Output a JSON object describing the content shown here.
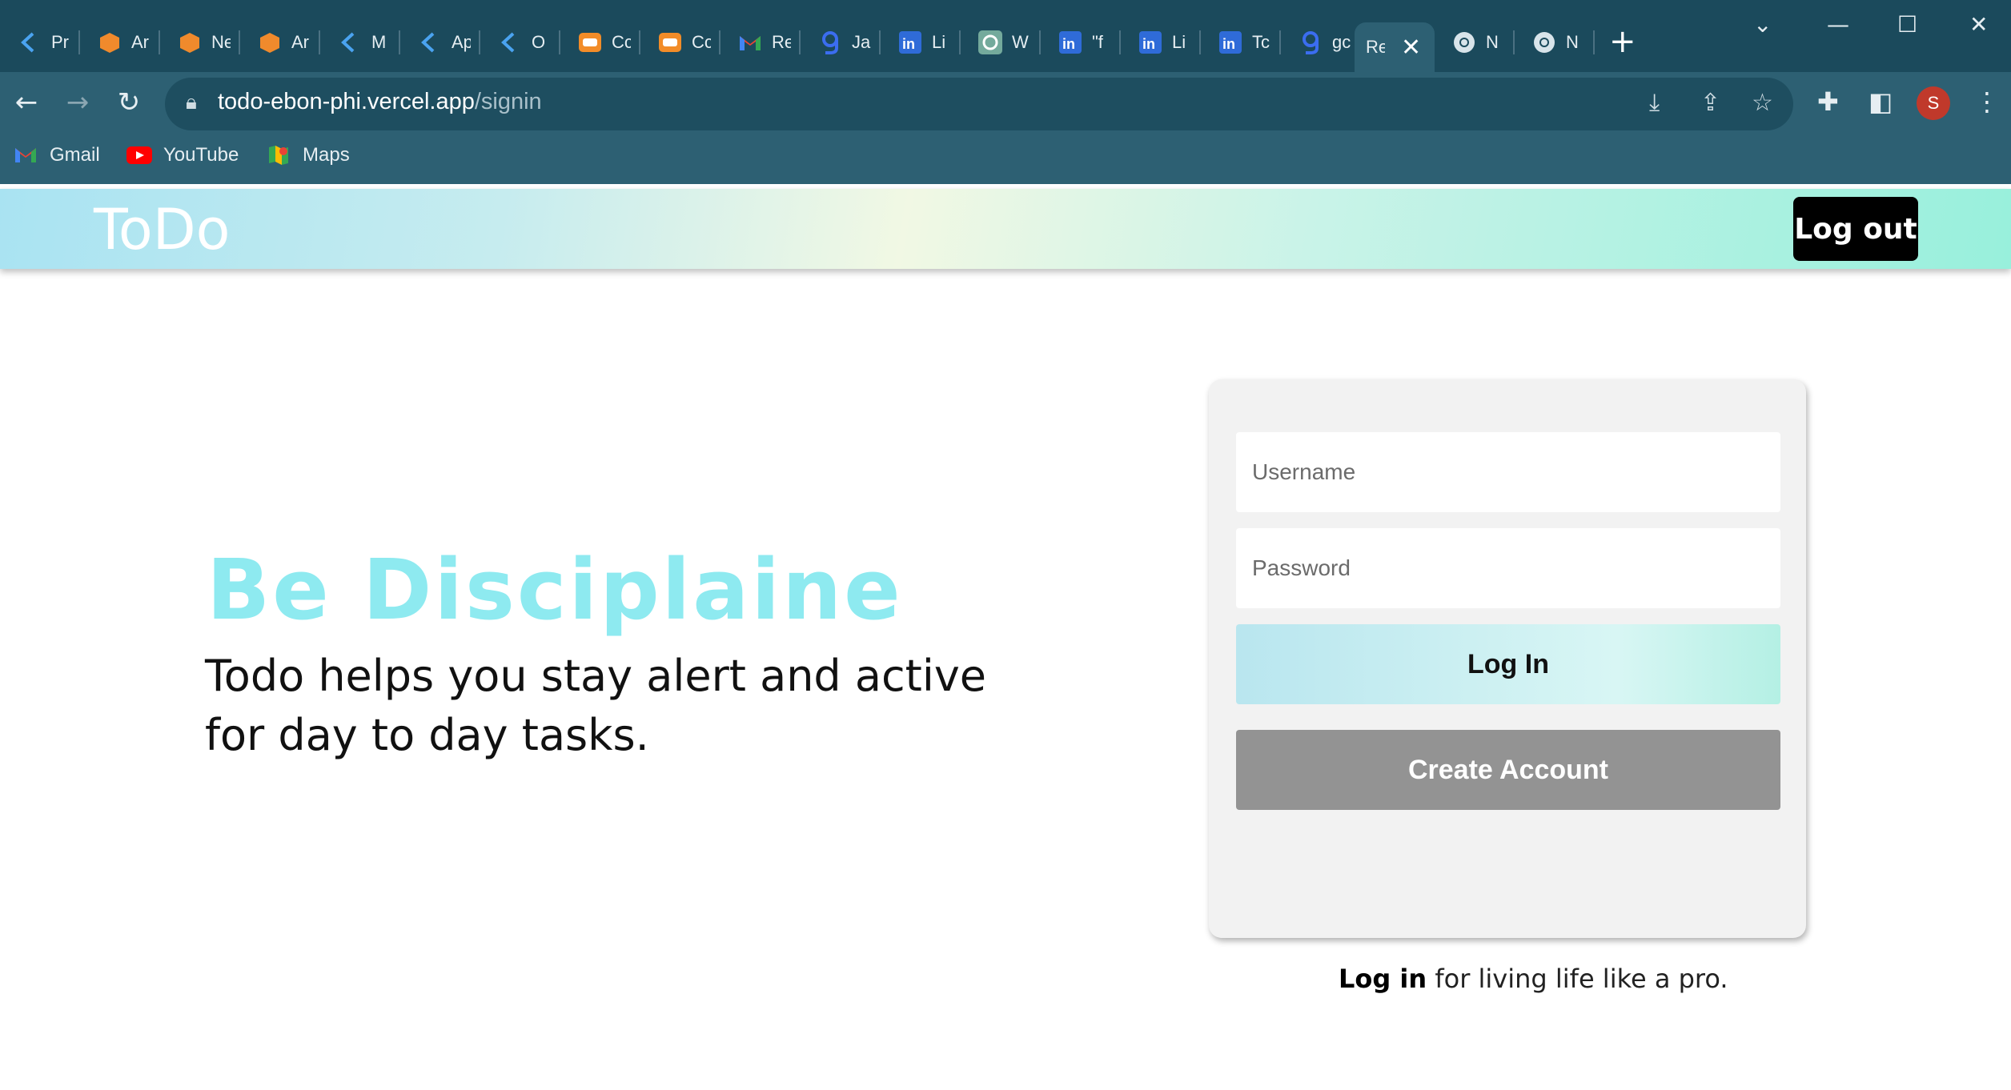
{
  "browser": {
    "tabs": [
      {
        "title": "Pr",
        "icon": "k-icon"
      },
      {
        "title": "Ar",
        "icon": "box-icon"
      },
      {
        "title": "Ne",
        "icon": "box-icon"
      },
      {
        "title": "Ar",
        "icon": "box-icon"
      },
      {
        "title": "M",
        "icon": "k-icon"
      },
      {
        "title": "Ap",
        "icon": "k-icon"
      },
      {
        "title": "O",
        "icon": "k-icon"
      },
      {
        "title": "Cc",
        "icon": "codechef-icon"
      },
      {
        "title": "Cc",
        "icon": "codechef-icon"
      },
      {
        "title": "Re",
        "icon": "gmail-icon"
      },
      {
        "title": "Ja",
        "icon": "g-icon"
      },
      {
        "title": "Li",
        "icon": "linkedin-icon"
      },
      {
        "title": "W",
        "icon": "openai-icon"
      },
      {
        "title": "\"f",
        "icon": "linkedin-icon"
      },
      {
        "title": "Li",
        "icon": "linkedin-icon"
      },
      {
        "title": "Tc",
        "icon": "linkedin-icon"
      },
      {
        "title": "gc",
        "icon": "g-icon"
      },
      {
        "title": "Re",
        "icon": "none",
        "active": true
      },
      {
        "title": "N",
        "icon": "chrome-icon"
      },
      {
        "title": "N",
        "icon": "chrome-icon"
      }
    ],
    "url_host": "todo-ebon-phi.vercel.app",
    "url_path": "/signin",
    "profile_initial": "S",
    "bookmarks": [
      {
        "label": "Gmail",
        "icon": "gmail-icon"
      },
      {
        "label": "YouTube",
        "icon": "youtube-icon"
      },
      {
        "label": "Maps",
        "icon": "maps-icon"
      }
    ]
  },
  "header": {
    "brand": "ToDo",
    "logout_label": "Log out"
  },
  "hero": {
    "title": "Be Disciplaine",
    "subtitle": "Todo helps you stay alert and active for day to day tasks."
  },
  "login_card": {
    "username_placeholder": "Username",
    "username_value": "",
    "password_placeholder": "Password",
    "password_value": "",
    "login_label": "Log In",
    "create_label": "Create Account"
  },
  "tagline": {
    "bold": "Log in",
    "rest": " for living life like a pro."
  },
  "colors": {
    "chrome_dark": "#1b4a5c",
    "chrome_toolbar": "#2d6073",
    "hero_title": "#8eeaf0",
    "create_button": "#939393",
    "logout_button": "#000000"
  }
}
